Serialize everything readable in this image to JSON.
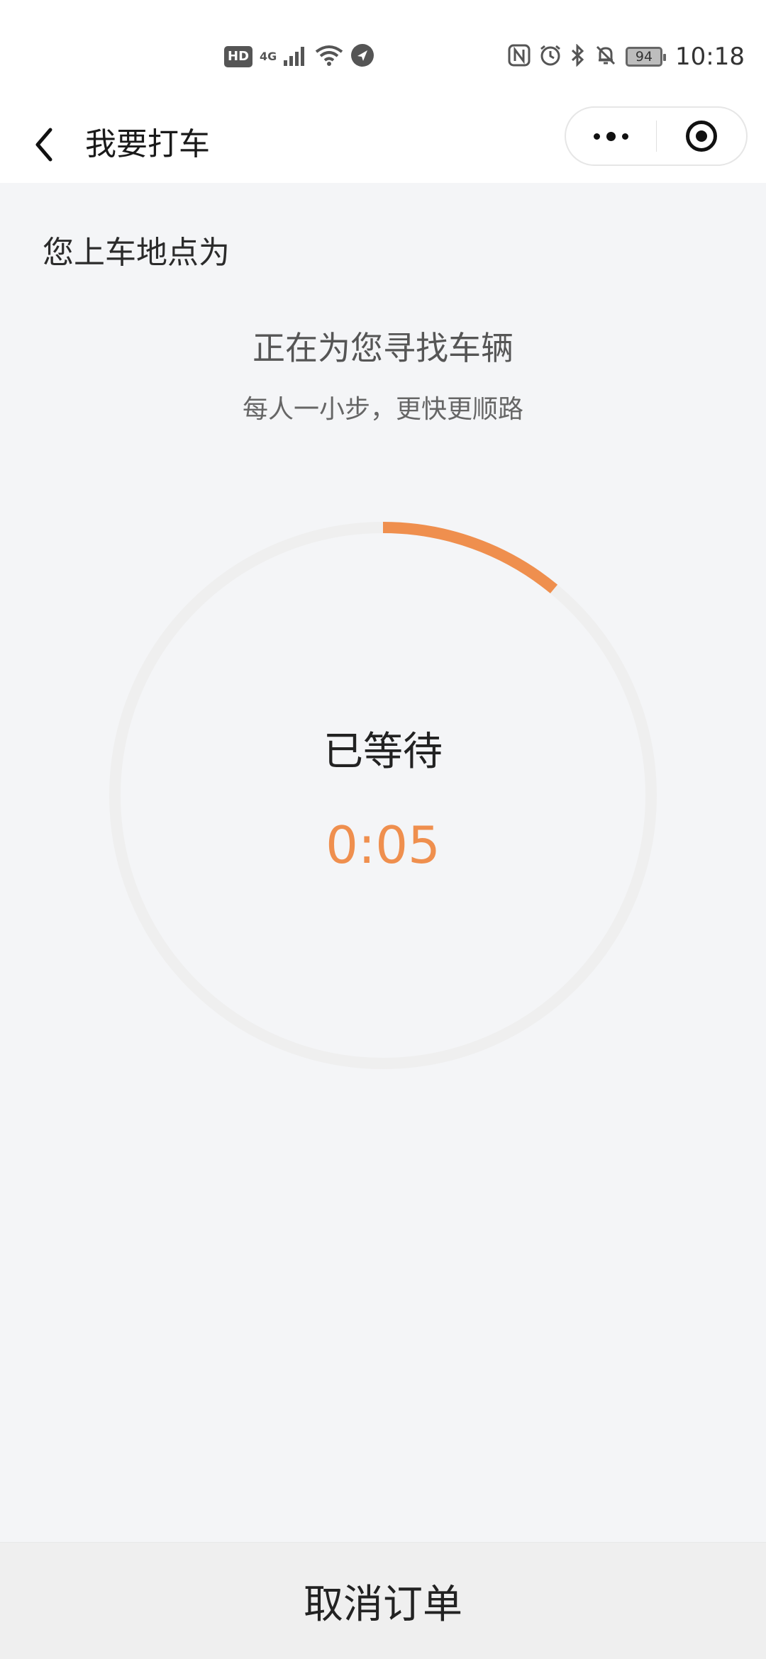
{
  "status_bar": {
    "hd": "HD",
    "network": "4G",
    "battery": "94",
    "time": "10:18"
  },
  "nav": {
    "title": "我要打车"
  },
  "main": {
    "pickup_label": "您上车地点为",
    "searching_text": "正在为您寻找车辆",
    "slogan": "每人一小步，更快更顺路",
    "waited_label": "已等待",
    "timer": "0:05",
    "progress_fraction": 0.11
  },
  "footer": {
    "cancel_label": "取消订单"
  },
  "colors": {
    "accent": "#ef8f4e",
    "ring_track": "#efefef",
    "background": "#f4f5f7"
  }
}
